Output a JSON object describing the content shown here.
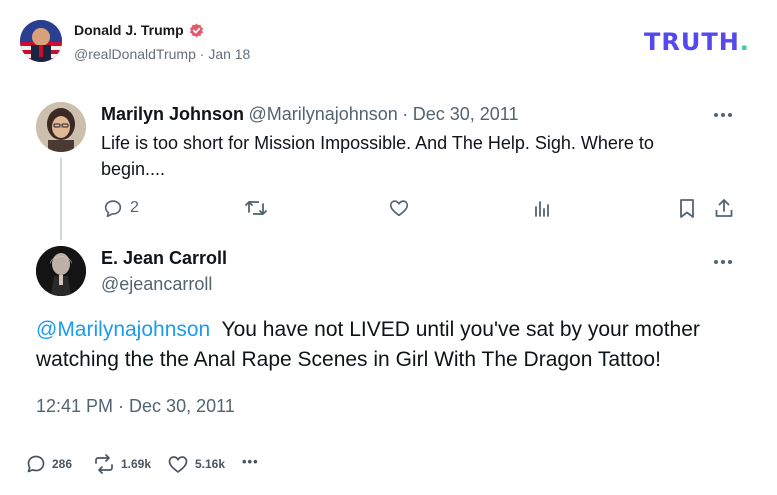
{
  "post": {
    "author_name": "Donald J. Trump",
    "author_handle": "@realDonaldTrump",
    "separator": "·",
    "date": "Jan 18",
    "verified_icon": "verified-badge-icon",
    "brand_logo": "TRUTH",
    "brand_dot": ".",
    "brand_color": "#5448ee",
    "brand_dot_color": "#37d0a4"
  },
  "quoted": {
    "reply": {
      "name": "Marilyn Johnson",
      "handle": "@Marilynajohnson",
      "separator": "·",
      "date": "Dec 30, 2011",
      "text_line1": "Life is too short for Mission Impossible. And The Help. Sigh. Where to",
      "text_line2": "begin....",
      "reply_count": "2"
    },
    "main": {
      "name": "E. Jean Carroll",
      "handle": "@ejeancarroll",
      "mention": "@Marilynajohnson",
      "text_line1_rest": "You have not LIVED until you've sat by your mother",
      "text_line2": "watching the the Anal Rape Scenes in Girl With The Dragon Tattoo!",
      "timestamp": "12:41 PM · Dec 30, 2011"
    },
    "accent_color": "#1d9bf0"
  },
  "stats": {
    "replies": "286",
    "retruths": "1.69k",
    "likes": "5.16k",
    "more": "•••"
  }
}
